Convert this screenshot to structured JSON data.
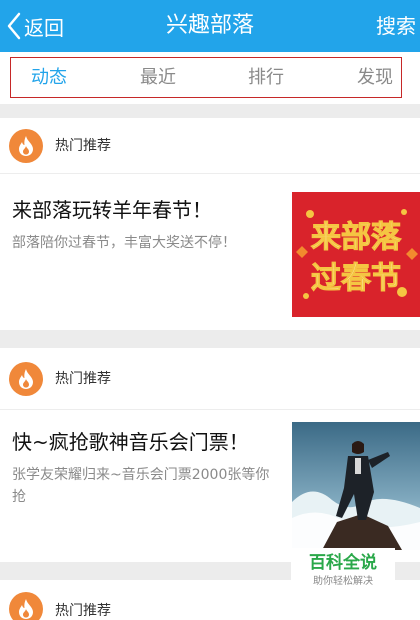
{
  "header": {
    "back_label": "返回",
    "title": "兴趣部落",
    "search_label": "搜索"
  },
  "tabs": [
    {
      "label": "动态",
      "active": true
    },
    {
      "label": "最近",
      "active": false
    },
    {
      "label": "排行",
      "active": false
    },
    {
      "label": "发现",
      "active": false
    }
  ],
  "cards": [
    {
      "label": "热门推荐",
      "title": "来部落玩转羊年春节！",
      "desc": "部落陪你过春节，丰富大奖送不停！",
      "thumb_text": [
        "来部落",
        "过春节"
      ]
    },
    {
      "label": "热门推荐",
      "title": "快~疯抢歌神音乐会门票！",
      "desc": "张学友荣耀归来~音乐会门票2000张等你抢"
    },
    {
      "label": "热门推荐"
    }
  ],
  "watermark": {
    "main": "百科全说",
    "sub": "助你轻松解决"
  },
  "colors": {
    "accent": "#22a4ea",
    "fire_badge": "#f0883a",
    "tab_highlight_border": "#c62828"
  }
}
